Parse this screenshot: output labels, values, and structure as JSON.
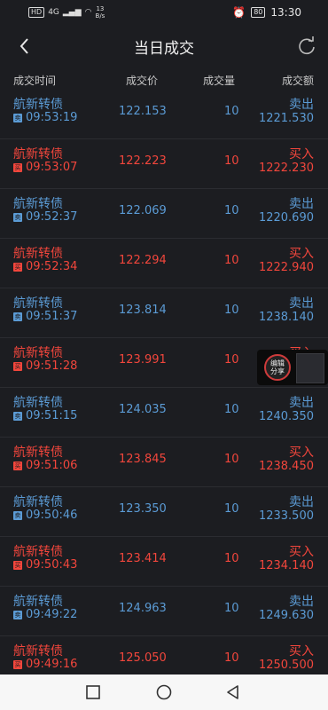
{
  "status_bar": {
    "hd": "HD",
    "signal": "4G",
    "speed_value": "13",
    "speed_unit": "B/s",
    "battery": "80",
    "time": "13:30"
  },
  "header": {
    "title": "当日成交"
  },
  "columns": {
    "time": "成交时间",
    "price": "成交价",
    "qty": "成交量",
    "amount": "成交额"
  },
  "rows": [
    {
      "name": "航新转债",
      "tag": "卖",
      "time": "09:53:19",
      "price": "122.153",
      "qty": "10",
      "side": "卖出",
      "amount": "1221.530",
      "type": "sell"
    },
    {
      "name": "航新转债",
      "tag": "买",
      "time": "09:53:07",
      "price": "122.223",
      "qty": "10",
      "side": "买入",
      "amount": "1222.230",
      "type": "buy"
    },
    {
      "name": "航新转债",
      "tag": "卖",
      "time": "09:52:37",
      "price": "122.069",
      "qty": "10",
      "side": "卖出",
      "amount": "1220.690",
      "type": "sell"
    },
    {
      "name": "航新转债",
      "tag": "买",
      "time": "09:52:34",
      "price": "122.294",
      "qty": "10",
      "side": "买入",
      "amount": "1222.940",
      "type": "buy"
    },
    {
      "name": "航新转债",
      "tag": "卖",
      "time": "09:51:37",
      "price": "123.814",
      "qty": "10",
      "side": "卖出",
      "amount": "1238.140",
      "type": "sell"
    },
    {
      "name": "航新转债",
      "tag": "买",
      "time": "09:51:28",
      "price": "123.991",
      "qty": "10",
      "side": "买入",
      "amount": "",
      "type": "buy"
    },
    {
      "name": "航新转债",
      "tag": "卖",
      "time": "09:51:15",
      "price": "124.035",
      "qty": "10",
      "side": "卖出",
      "amount": "1240.350",
      "type": "sell"
    },
    {
      "name": "航新转债",
      "tag": "买",
      "time": "09:51:06",
      "price": "123.845",
      "qty": "10",
      "side": "买入",
      "amount": "1238.450",
      "type": "buy"
    },
    {
      "name": "航新转债",
      "tag": "卖",
      "time": "09:50:46",
      "price": "123.350",
      "qty": "10",
      "side": "卖出",
      "amount": "1233.500",
      "type": "sell"
    },
    {
      "name": "航新转债",
      "tag": "买",
      "time": "09:50:43",
      "price": "123.414",
      "qty": "10",
      "side": "买入",
      "amount": "1234.140",
      "type": "buy"
    },
    {
      "name": "航新转债",
      "tag": "卖",
      "time": "09:49:22",
      "price": "124.963",
      "qty": "10",
      "side": "卖出",
      "amount": "1249.630",
      "type": "sell"
    },
    {
      "name": "航新转债",
      "tag": "买",
      "time": "09:49:16",
      "price": "125.050",
      "qty": "10",
      "side": "买入",
      "amount": "1250.500",
      "type": "buy"
    }
  ],
  "share_widget": {
    "line1": "编辑",
    "line2": "分享"
  },
  "colors": {
    "buy": "#f2463c",
    "sell": "#5b9bd5",
    "background": "#1c1d21"
  }
}
